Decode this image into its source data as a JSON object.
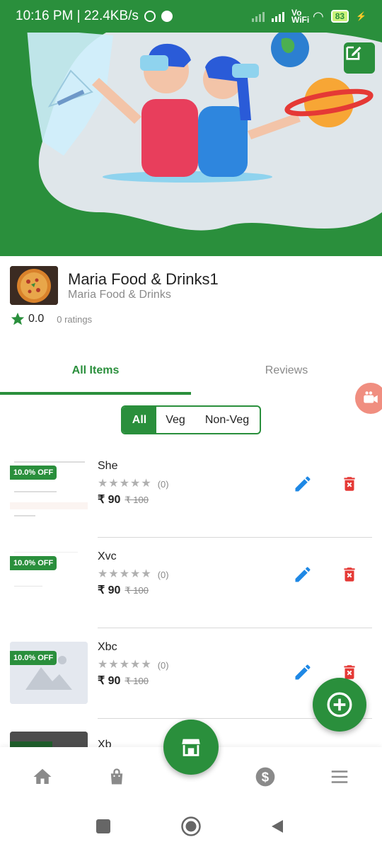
{
  "status_bar": {
    "time_speed": "10:16 PM | 22.4KB/s",
    "network": "Vo WiFi",
    "battery": "83"
  },
  "store": {
    "name": "Maria Food & Drinks1",
    "subtitle": "Maria Food & Drinks",
    "rating": "0.0",
    "rating_count": "0 ratings"
  },
  "tabs": [
    {
      "label": "All Items",
      "active": true
    },
    {
      "label": "Reviews",
      "active": false
    }
  ],
  "filter": {
    "options": [
      "All",
      "Veg",
      "Non-Veg"
    ],
    "selected": "All"
  },
  "items": [
    {
      "name": "She",
      "discount": "10.0% OFF",
      "reviews": "(0)",
      "price": "₹ 90",
      "old_price": "₹ 100",
      "thumb": "screenshot"
    },
    {
      "name": "Xvc",
      "discount": "10.0% OFF",
      "reviews": "(0)",
      "price": "₹ 90",
      "old_price": "₹ 100",
      "thumb": "blank"
    },
    {
      "name": "Xbc",
      "discount": "10.0% OFF",
      "reviews": "(0)",
      "price": "₹ 90",
      "old_price": "₹ 100",
      "thumb": "placeholder"
    },
    {
      "name": "Xb",
      "discount": "",
      "reviews": "",
      "price": "",
      "old_price": "",
      "thumb": "dark"
    }
  ],
  "icons": {
    "accent": "#2a8f3c",
    "edit": "#1e88e5",
    "delete": "#e53935",
    "nav": "#8a8a8a"
  }
}
